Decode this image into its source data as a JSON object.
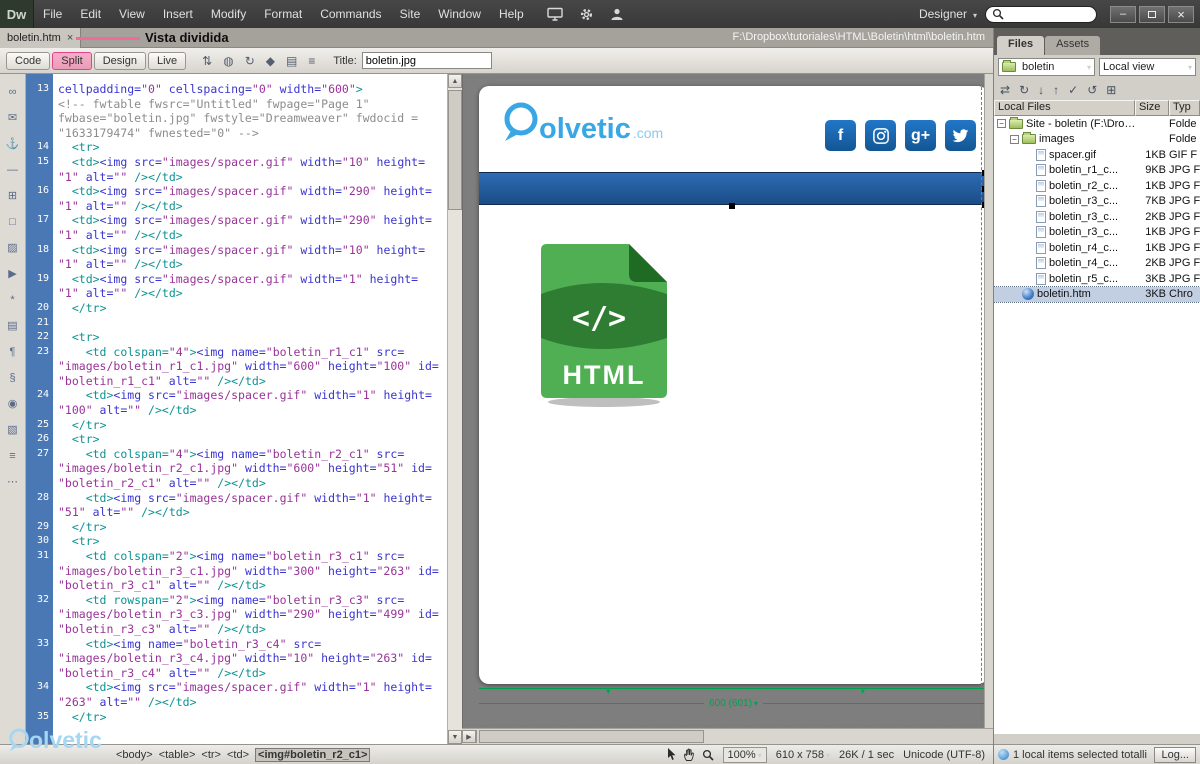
{
  "colors": {
    "accent_blue": "#1a4c86",
    "solvetic_blue": "#3aa7e5",
    "social_blue": "#1b6ec2",
    "measure_green": "#00a14e",
    "annotation_pink": "#f2699f",
    "code_tag": "#3a35d1",
    "code_table_tag": "#0f9292",
    "code_value": "#993399",
    "code_comment": "#8c8c8c",
    "html_icon_green": "#4faf52"
  },
  "menubar": {
    "logo": "Dw",
    "items": [
      "File",
      "Edit",
      "View",
      "Insert",
      "Modify",
      "Format",
      "Commands",
      "Site",
      "Window",
      "Help"
    ],
    "icons": [
      {
        "name": "layout-selector-icon",
        "svg": "monitor"
      },
      {
        "name": "extensions-gear-icon",
        "svg": "gear"
      },
      {
        "name": "sites-user-icon",
        "svg": "user"
      }
    ],
    "workspace": "Designer",
    "search_value": ""
  },
  "tabbar": {
    "tab_label": "boletin.htm",
    "annotation": "Vista dividida",
    "file_path": "F:\\Dropbox\\tutoriales\\HTML\\Boletin\\html\\boletin.htm"
  },
  "doc_toolbar": {
    "views": [
      {
        "label": "Code"
      },
      {
        "label": "Split",
        "highlight": true
      },
      {
        "label": "Design"
      },
      {
        "label": "Live"
      }
    ],
    "icons": [
      {
        "name": "file-management-icon",
        "glyph": "⇅"
      },
      {
        "name": "preview-in-browser-icon",
        "glyph": "◍"
      },
      {
        "name": "refresh-icon",
        "glyph": "↻"
      },
      {
        "name": "code-navigator-icon",
        "glyph": "◆"
      },
      {
        "name": "visual-aids-icon",
        "glyph": "▤"
      },
      {
        "name": "view-options-icon",
        "glyph": "≡"
      }
    ],
    "title_label": "Title:",
    "title_value": "boletin.jpg"
  },
  "insert_panel": {
    "icons": [
      {
        "name": "insert-hyperlink-icon",
        "glyph": "∞"
      },
      {
        "name": "insert-email-link-icon",
        "glyph": "✉"
      },
      {
        "name": "insert-named-anchor-icon",
        "glyph": "⚓"
      },
      {
        "name": "insert-horizontal-rule-icon",
        "glyph": "―"
      },
      {
        "name": "insert-table-icon",
        "glyph": "⊞"
      },
      {
        "name": "insert-div-tag-icon",
        "glyph": "□"
      },
      {
        "name": "insert-image-icon",
        "glyph": "▨"
      },
      {
        "name": "insert-media-icon",
        "glyph": "▶"
      },
      {
        "name": "insert-widget-icon",
        "glyph": "*"
      },
      {
        "name": "insert-date-icon",
        "glyph": "▤"
      },
      {
        "name": "insert-comment-icon",
        "glyph": "¶"
      },
      {
        "name": "insert-script-icon",
        "glyph": "§"
      },
      {
        "name": "insert-head-icon",
        "glyph": "◉"
      },
      {
        "name": "insert-template-icon",
        "glyph": "▧"
      },
      {
        "name": "insert-tag-chooser-icon",
        "glyph": "≡"
      },
      {
        "name": "insert-more-icon",
        "glyph": "⋯"
      }
    ]
  },
  "code_editor": {
    "lines": [
      {
        "n": "13",
        "t": "cellpadding=\"0\" cellspacing=\"0\" width=\"600\">\n<!-- fwtable fwsrc=\"Untitled\" fwpage=\"Page 1\"\nfwbase=\"boletin.jpg\" fwstyle=\"Dreamweaver\" fwdocid =\n\"1633179474\" fwnested=\"0\" -->"
      },
      {
        "n": "14",
        "t": "  <tr>"
      },
      {
        "n": "15",
        "t": "  <td><img src=\"images/spacer.gif\" width=\"10\" height=\n\"1\" alt=\"\" /></td>"
      },
      {
        "n": "16",
        "t": "  <td><img src=\"images/spacer.gif\" width=\"290\" height=\n\"1\" alt=\"\" /></td>"
      },
      {
        "n": "17",
        "t": "  <td><img src=\"images/spacer.gif\" width=\"290\" height=\n\"1\" alt=\"\" /></td>"
      },
      {
        "n": "18",
        "t": "  <td><img src=\"images/spacer.gif\" width=\"10\" height=\n\"1\" alt=\"\" /></td>"
      },
      {
        "n": "19",
        "t": "  <td><img src=\"images/spacer.gif\" width=\"1\" height=\n\"1\" alt=\"\" /></td>"
      },
      {
        "n": "20",
        "t": "  </tr>"
      },
      {
        "n": "21",
        "t": ""
      },
      {
        "n": "22",
        "t": "  <tr>"
      },
      {
        "n": "23",
        "t": "    <td colspan=\"4\"><img name=\"boletin_r1_c1\" src=\n\"images/boletin_r1_c1.jpg\" width=\"600\" height=\"100\" id=\n\"boletin_r1_c1\" alt=\"\" /></td>"
      },
      {
        "n": "24",
        "t": "    <td><img src=\"images/spacer.gif\" width=\"1\" height=\n\"100\" alt=\"\" /></td>"
      },
      {
        "n": "25",
        "t": "  </tr>"
      },
      {
        "n": "26",
        "t": "  <tr>"
      },
      {
        "n": "27",
        "t": "    <td colspan=\"4\"><img name=\"boletin_r2_c1\" src=\n\"images/boletin_r2_c1.jpg\" width=\"600\" height=\"51\" id=\n\"boletin_r2_c1\" alt=\"\" /></td>"
      },
      {
        "n": "28",
        "t": "    <td><img src=\"images/spacer.gif\" width=\"1\" height=\n\"51\" alt=\"\" /></td>"
      },
      {
        "n": "29",
        "t": "  </tr>"
      },
      {
        "n": "30",
        "t": "  <tr>"
      },
      {
        "n": "31",
        "t": "    <td colspan=\"2\"><img name=\"boletin_r3_c1\" src=\n\"images/boletin_r3_c1.jpg\" width=\"300\" height=\"263\" id=\n\"boletin_r3_c1\" alt=\"\" /></td>"
      },
      {
        "n": "32",
        "t": "    <td rowspan=\"2\"><img name=\"boletin_r3_c3\" src=\n\"images/boletin_r3_c3.jpg\" width=\"290\" height=\"499\" id=\n\"boletin_r3_c3\" alt=\"\" /></td>"
      },
      {
        "n": "33",
        "t": "    <td><img name=\"boletin_r3_c4\" src=\n\"images/boletin_r3_c4.jpg\" width=\"10\" height=\"263\" id=\n\"boletin_r3_c4\" alt=\"\" /></td>"
      },
      {
        "n": "34",
        "t": "    <td><img src=\"images/spacer.gif\" width=\"1\" height=\n\"263\" alt=\"\" /></td>"
      },
      {
        "n": "35",
        "t": "  </tr>"
      }
    ]
  },
  "design": {
    "logo_text": "olvetic",
    "logo_suffix": ".com",
    "social_icons": [
      {
        "name": "facebook-icon",
        "glyph": "f"
      },
      {
        "name": "instagram-icon",
        "svg": "instagram"
      },
      {
        "name": "googleplus-icon",
        "glyph": "g+"
      },
      {
        "name": "twitter-icon",
        "svg": "twitter"
      }
    ],
    "html_icon_code": "</>",
    "html_icon_label": "HTML",
    "table_width_label": "600 (601)"
  },
  "status_bar": {
    "tags": [
      {
        "label": "<body>"
      },
      {
        "label": "<table>"
      },
      {
        "label": "<tr>"
      },
      {
        "label": "<td>"
      },
      {
        "label": "<img#boletin_r2_c1>",
        "selected": true
      }
    ],
    "tools": [
      {
        "name": "select-tool-icon",
        "svg": "pointer"
      },
      {
        "name": "hand-tool-icon",
        "svg": "hand"
      },
      {
        "name": "zoom-tool-icon",
        "svg": "magnifier"
      }
    ],
    "zoom": "100%",
    "dimensions": "610 x 758",
    "size_time": "26K / 1 sec",
    "encoding": "Unicode (UTF-8)"
  },
  "files_panel": {
    "tabs": [
      {
        "label": "Files",
        "active": true
      },
      {
        "label": "Assets"
      }
    ],
    "site_select": "boletin",
    "view_select": "Local view",
    "toolbar_icons": [
      {
        "name": "connect-icon",
        "glyph": "⇄"
      },
      {
        "name": "refresh-icon",
        "glyph": "↻"
      },
      {
        "name": "get-files-icon",
        "glyph": "↓"
      },
      {
        "name": "put-files-icon",
        "glyph": "↑"
      },
      {
        "name": "check-out-icon",
        "glyph": "✓"
      },
      {
        "name": "synchronize-icon",
        "glyph": "↺"
      },
      {
        "name": "expand-icon",
        "glyph": "⊞"
      }
    ],
    "columns": {
      "name": "Local Files",
      "size": "Size",
      "type": "Typ"
    },
    "rows": [
      {
        "name": "Site - boletin (F:\\Drop...",
        "size": "",
        "type": "Folde",
        "icon": "folder",
        "indent": 0,
        "expander": true
      },
      {
        "name": "images",
        "size": "",
        "type": "Folde",
        "icon": "folder",
        "indent": 1,
        "expander": true
      },
      {
        "name": "spacer.gif",
        "size": "1KB",
        "type": "GIF F",
        "icon": "file",
        "indent": 2
      },
      {
        "name": "boletin_r1_c...",
        "size": "9KB",
        "type": "JPG F",
        "icon": "file",
        "indent": 2
      },
      {
        "name": "boletin_r2_c...",
        "size": "1KB",
        "type": "JPG F",
        "icon": "file",
        "indent": 2
      },
      {
        "name": "boletin_r3_c...",
        "size": "7KB",
        "type": "JPG F",
        "icon": "file",
        "indent": 2
      },
      {
        "name": "boletin_r3_c...",
        "size": "2KB",
        "type": "JPG F",
        "icon": "file",
        "indent": 2
      },
      {
        "name": "boletin_r3_c...",
        "size": "1KB",
        "type": "JPG F",
        "icon": "file",
        "indent": 2
      },
      {
        "name": "boletin_r4_c...",
        "size": "1KB",
        "type": "JPG F",
        "icon": "file",
        "indent": 2
      },
      {
        "name": "boletin_r4_c...",
        "size": "2KB",
        "type": "JPG F",
        "icon": "file",
        "indent": 2
      },
      {
        "name": "boletin_r5_c...",
        "size": "3KB",
        "type": "JPG F",
        "icon": "file",
        "indent": 2
      },
      {
        "name": "boletin.htm",
        "size": "3KB",
        "type": "Chro",
        "icon": "html",
        "indent": 1,
        "selected": true
      }
    ],
    "status_text": "1 local items selected totalli",
    "log_button": "Log..."
  },
  "watermark": {
    "text": "olvetic"
  }
}
